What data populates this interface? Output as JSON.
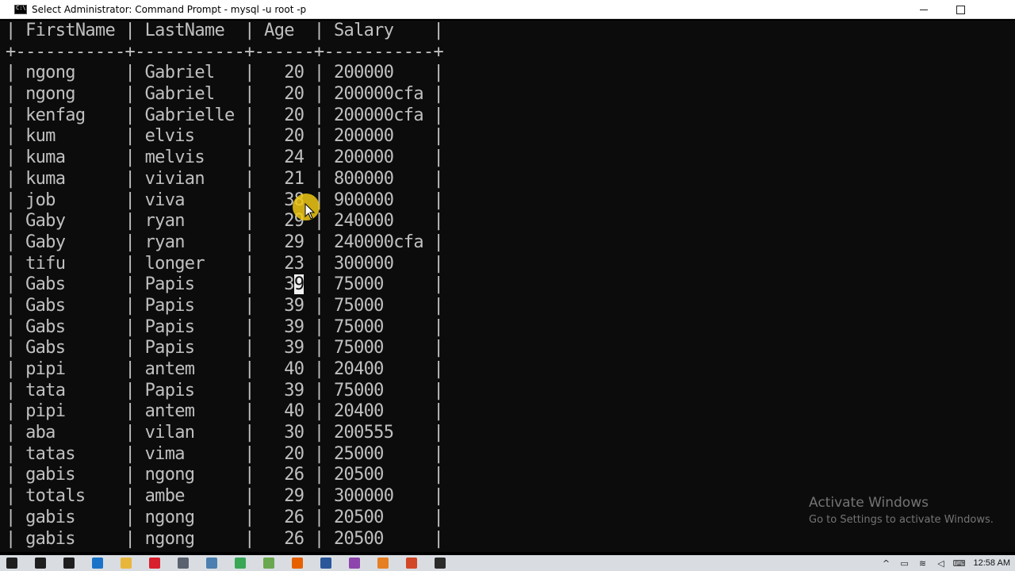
{
  "window": {
    "title": "Select Administrator: Command Prompt - mysql  -u root -p",
    "controls": {
      "minimize": "—",
      "maximize": "☐",
      "close": "✕"
    }
  },
  "table": {
    "header_line": "| FirstName | LastName  | Age  | Salary    |",
    "separator_line": "+-----------+-----------+------+-----------+",
    "columns": [
      "FirstName",
      "LastName",
      "Age",
      "Salary"
    ],
    "rows": [
      [
        "ngong",
        "Gabriel",
        "20",
        "200000"
      ],
      [
        "ngong",
        "Gabriel",
        "20",
        "200000cfa"
      ],
      [
        "kenfag",
        "Gabrielle",
        "20",
        "200000cfa"
      ],
      [
        "kum",
        "elvis",
        "20",
        "200000"
      ],
      [
        "kuma",
        "melvis",
        "24",
        "200000"
      ],
      [
        "kuma",
        "vivian",
        "21",
        "800000"
      ],
      [
        "job",
        "viva",
        "38",
        "900000"
      ],
      [
        "Gaby",
        "ryan",
        "29",
        "240000"
      ],
      [
        "Gaby",
        "ryan",
        "29",
        "240000cfa"
      ],
      [
        "tifu",
        "longer",
        "23",
        "300000"
      ],
      [
        "Gabs",
        "Papis",
        "39",
        "75000"
      ],
      [
        "Gabs",
        "Papis",
        "39",
        "75000"
      ],
      [
        "Gabs",
        "Papis",
        "39",
        "75000"
      ],
      [
        "Gabs",
        "Papis",
        "39",
        "75000"
      ],
      [
        "pipi",
        "antem",
        "40",
        "20400"
      ],
      [
        "tata",
        "Papis",
        "39",
        "75000"
      ],
      [
        "pipi",
        "antem",
        "40",
        "20400"
      ],
      [
        "aba",
        "vilan",
        "30",
        "200555"
      ],
      [
        "tatas",
        "vima",
        "20",
        "25000"
      ],
      [
        "gabis",
        "ngong",
        "26",
        "20500"
      ],
      [
        "totals",
        "ambe",
        "29",
        "300000"
      ],
      [
        "gabis",
        "ngong",
        "26",
        "20500"
      ],
      [
        "gabis",
        "ngong",
        "26",
        "20500"
      ]
    ]
  },
  "watermark": {
    "line1": "Activate Windows",
    "line2": "Go to Settings to activate Windows."
  },
  "taskbar": {
    "clock": "12:58 AM",
    "apps": [
      {
        "name": "windows-start-icon",
        "color": "#1f1f1f"
      },
      {
        "name": "search-icon",
        "color": "#1f1f1f"
      },
      {
        "name": "task-view-icon",
        "color": "#1f1f1f"
      },
      {
        "name": "edge-icon",
        "color": "#1a73c8"
      },
      {
        "name": "file-explorer-icon",
        "color": "#e8b63c"
      },
      {
        "name": "opera-icon",
        "color": "#d8202c"
      },
      {
        "name": "app-window-icon",
        "color": "#5a6270"
      },
      {
        "name": "app-window-2-icon",
        "color": "#4a7fb0"
      },
      {
        "name": "chrome-icon",
        "color": "#3aa757"
      },
      {
        "name": "notepad-icon",
        "color": "#6aa84f"
      },
      {
        "name": "firefox-icon",
        "color": "#e66000"
      },
      {
        "name": "word-icon",
        "color": "#2b579a"
      },
      {
        "name": "media-icon",
        "color": "#8e44ad"
      },
      {
        "name": "sublime-icon",
        "color": "#e67e22"
      },
      {
        "name": "powerpoint-icon",
        "color": "#d24726"
      },
      {
        "name": "cmd-icon",
        "color": "#2b2b2b"
      }
    ]
  }
}
